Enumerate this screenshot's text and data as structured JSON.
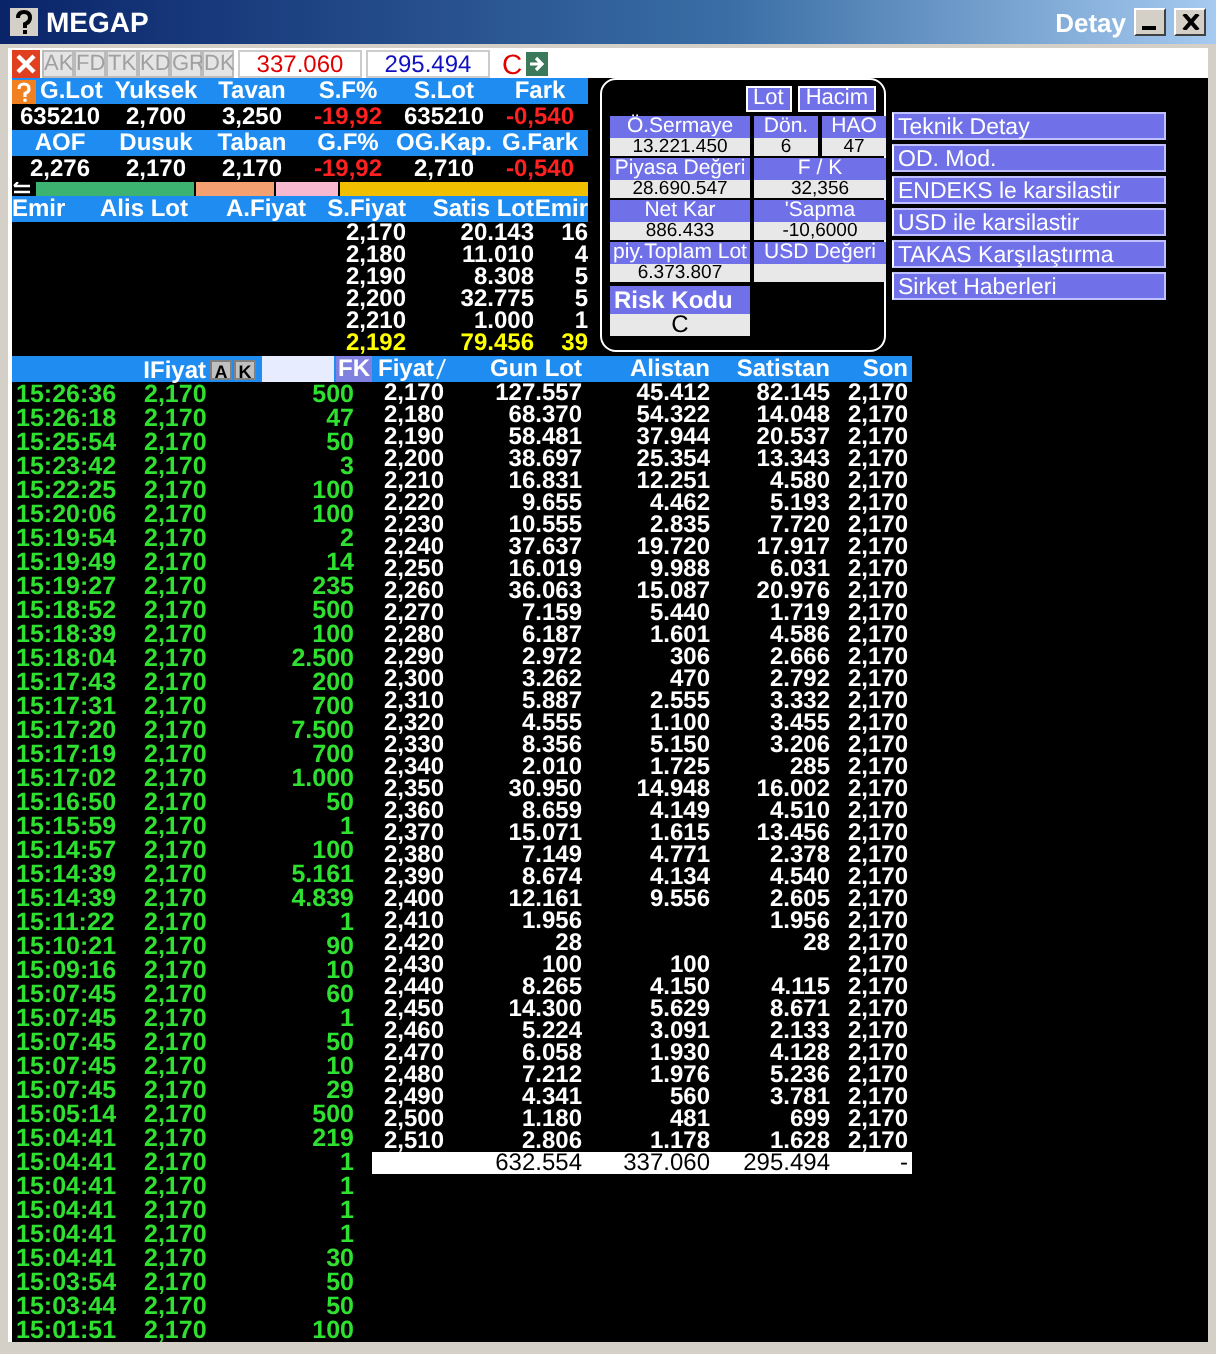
{
  "window": {
    "title": "MEGAP",
    "subtitle": "Detay"
  },
  "toolbar": {
    "tabs": [
      {
        "label": "AK",
        "disabled": true
      },
      {
        "label": "FD",
        "disabled": true
      },
      {
        "label": "TK",
        "disabled": true
      },
      {
        "label": "KD",
        "disabled": true
      },
      {
        "label": "GR",
        "disabled": true
      },
      {
        "label": "DK",
        "disabled": true
      }
    ],
    "buy_total": "337.060",
    "sell_total": "295.494",
    "code": "C"
  },
  "stats": [
    {
      "headers": [
        "G.Lot",
        "Yuksek",
        "Tavan",
        "S.F%",
        "S.Lot",
        "Fark"
      ],
      "values": [
        {
          "text": "635210",
          "negative": false
        },
        {
          "text": "2,700",
          "negative": false
        },
        {
          "text": "3,250",
          "negative": false
        },
        {
          "text": "-19,92",
          "negative": true
        },
        {
          "text": "635210",
          "negative": false
        },
        {
          "text": "-0,540",
          "negative": true
        }
      ]
    },
    {
      "headers": [
        "AOF",
        "Dusuk",
        "Taban",
        "G.F%",
        "OG.Kap.",
        "G.Fark"
      ],
      "values": [
        {
          "text": "2,276",
          "negative": false
        },
        {
          "text": "2,170",
          "negative": false
        },
        {
          "text": "2,170",
          "negative": false
        },
        {
          "text": "-19,92",
          "negative": true
        },
        {
          "text": "2,710",
          "negative": false
        },
        {
          "text": "-0,540",
          "negative": true
        }
      ]
    }
  ],
  "order_book": {
    "columns": [
      "Emir",
      "Alis Lot",
      "A.Fiyat",
      "S.Fiyat",
      "Satis Lot",
      "Emir"
    ],
    "rows": [
      {
        "s_fiyat": "2,170",
        "satis_lot": "20.143",
        "emir": "16"
      },
      {
        "s_fiyat": "2,180",
        "satis_lot": "11.010",
        "emir": "4"
      },
      {
        "s_fiyat": "2,190",
        "satis_lot": "8.308",
        "emir": "5"
      },
      {
        "s_fiyat": "2,200",
        "satis_lot": "32.775",
        "emir": "5"
      },
      {
        "s_fiyat": "2,210",
        "satis_lot": "1.000",
        "emir": "1"
      }
    ],
    "total": {
      "s_fiyat": "2,192",
      "satis_lot": "79.456",
      "emir": "39"
    }
  },
  "detail": {
    "modes": [
      {
        "label": "Lot",
        "selected": false
      },
      {
        "label": "Hacim",
        "selected": false
      }
    ],
    "fields": [
      {
        "kind": "left",
        "label": "Ö.Sermaye",
        "value": "13.221.450"
      },
      {
        "kind": "half",
        "label": "Dön.",
        "value": "6"
      },
      {
        "kind": "half",
        "label": "HAO",
        "value": "47"
      },
      {
        "kind": "left",
        "label": "Piyasa Değeri",
        "value": "28.690.547"
      },
      {
        "kind": "right",
        "label": "F / K",
        "value": "32,356"
      },
      {
        "kind": "left",
        "label": "Net Kar",
        "value": "886.433"
      },
      {
        "kind": "right",
        "label": "'Sapma",
        "value": "-10,6000"
      },
      {
        "kind": "left",
        "label": "piy.Toplam Lot",
        "value": "6.373.807"
      },
      {
        "kind": "right",
        "label": "USD Değeri"
      }
    ],
    "risk": {
      "label": "Risk Kodu",
      "value": "C"
    }
  },
  "links": [
    "Teknik Detay",
    "OD. Mod.",
    "ENDEKS le karsilastir",
    "USD ile karsilastir",
    "TAKAS Karşılaştırma",
    "Sirket Haberleri"
  ],
  "trades": {
    "header": "IFiyat",
    "buttons": [
      "A",
      "K"
    ],
    "filter_button": "FK",
    "rows": [
      [
        "15:26:36",
        "2,170",
        "500"
      ],
      [
        "15:26:18",
        "2,170",
        "47"
      ],
      [
        "15:25:54",
        "2,170",
        "50"
      ],
      [
        "15:23:42",
        "2,170",
        "3"
      ],
      [
        "15:22:25",
        "2,170",
        "100"
      ],
      [
        "15:20:06",
        "2,170",
        "100"
      ],
      [
        "15:19:54",
        "2,170",
        "2"
      ],
      [
        "15:19:49",
        "2,170",
        "14"
      ],
      [
        "15:19:27",
        "2,170",
        "235"
      ],
      [
        "15:18:52",
        "2,170",
        "500"
      ],
      [
        "15:18:39",
        "2,170",
        "100"
      ],
      [
        "15:18:04",
        "2,170",
        "2.500"
      ],
      [
        "15:17:43",
        "2,170",
        "200"
      ],
      [
        "15:17:31",
        "2,170",
        "700"
      ],
      [
        "15:17:20",
        "2,170",
        "7.500"
      ],
      [
        "15:17:19",
        "2,170",
        "700"
      ],
      [
        "15:17:02",
        "2,170",
        "1.000"
      ],
      [
        "15:16:50",
        "2,170",
        "50"
      ],
      [
        "15:15:59",
        "2,170",
        "1"
      ],
      [
        "15:14:57",
        "2,170",
        "100"
      ],
      [
        "15:14:39",
        "2,170",
        "5.161"
      ],
      [
        "15:14:39",
        "2,170",
        "4.839"
      ],
      [
        "15:11:22",
        "2,170",
        "1"
      ],
      [
        "15:10:21",
        "2,170",
        "90"
      ],
      [
        "15:09:16",
        "2,170",
        "10"
      ],
      [
        "15:07:45",
        "2,170",
        "60"
      ],
      [
        "15:07:45",
        "2,170",
        "1"
      ],
      [
        "15:07:45",
        "2,170",
        "50"
      ],
      [
        "15:07:45",
        "2,170",
        "10"
      ],
      [
        "15:07:45",
        "2,170",
        "29"
      ],
      [
        "15:05:14",
        "2,170",
        "500"
      ],
      [
        "15:04:41",
        "2,170",
        "219"
      ],
      [
        "15:04:41",
        "2,170",
        "1"
      ],
      [
        "15:04:41",
        "2,170",
        "1"
      ],
      [
        "15:04:41",
        "2,170",
        "1"
      ],
      [
        "15:04:41",
        "2,170",
        "1"
      ],
      [
        "15:04:41",
        "2,170",
        "30"
      ],
      [
        "15:03:54",
        "2,170",
        "50"
      ],
      [
        "15:03:44",
        "2,170",
        "50"
      ],
      [
        "15:01:51",
        "2,170",
        "100"
      ]
    ]
  },
  "price_table": {
    "columns": [
      "Fiyat",
      "Gun Lot",
      "Alistan",
      "Satistan",
      "Son"
    ],
    "rows": [
      [
        "2,170",
        "127.557",
        "45.412",
        "82.145",
        "2,170"
      ],
      [
        "2,180",
        "68.370",
        "54.322",
        "14.048",
        "2,170"
      ],
      [
        "2,190",
        "58.481",
        "37.944",
        "20.537",
        "2,170"
      ],
      [
        "2,200",
        "38.697",
        "25.354",
        "13.343",
        "2,170"
      ],
      [
        "2,210",
        "16.831",
        "12.251",
        "4.580",
        "2,170"
      ],
      [
        "2,220",
        "9.655",
        "4.462",
        "5.193",
        "2,170"
      ],
      [
        "2,230",
        "10.555",
        "2.835",
        "7.720",
        "2,170"
      ],
      [
        "2,240",
        "37.637",
        "19.720",
        "17.917",
        "2,170"
      ],
      [
        "2,250",
        "16.019",
        "9.988",
        "6.031",
        "2,170"
      ],
      [
        "2,260",
        "36.063",
        "15.087",
        "20.976",
        "2,170"
      ],
      [
        "2,270",
        "7.159",
        "5.440",
        "1.719",
        "2,170"
      ],
      [
        "2,280",
        "6.187",
        "1.601",
        "4.586",
        "2,170"
      ],
      [
        "2,290",
        "2.972",
        "306",
        "2.666",
        "2,170"
      ],
      [
        "2,300",
        "3.262",
        "470",
        "2.792",
        "2,170"
      ],
      [
        "2,310",
        "5.887",
        "2.555",
        "3.332",
        "2,170"
      ],
      [
        "2,320",
        "4.555",
        "1.100",
        "3.455",
        "2,170"
      ],
      [
        "2,330",
        "8.356",
        "5.150",
        "3.206",
        "2,170"
      ],
      [
        "2,340",
        "2.010",
        "1.725",
        "285",
        "2,170"
      ],
      [
        "2,350",
        "30.950",
        "14.948",
        "16.002",
        "2,170"
      ],
      [
        "2,360",
        "8.659",
        "4.149",
        "4.510",
        "2,170"
      ],
      [
        "2,370",
        "15.071",
        "1.615",
        "13.456",
        "2,170"
      ],
      [
        "2,380",
        "7.149",
        "4.771",
        "2.378",
        "2,170"
      ],
      [
        "2,390",
        "8.674",
        "4.134",
        "4.540",
        "2,170"
      ],
      [
        "2,400",
        "12.161",
        "9.556",
        "2.605",
        "2,170"
      ],
      [
        "2,410",
        "1.956",
        null,
        "1.956",
        "2,170"
      ],
      [
        "2,420",
        "28",
        null,
        "28",
        "2,170"
      ],
      [
        "2,430",
        "100",
        "100",
        null,
        "2,170"
      ],
      [
        "2,440",
        "8.265",
        "4.150",
        "4.115",
        "2,170"
      ],
      [
        "2,450",
        "14.300",
        "5.629",
        "8.671",
        "2,170"
      ],
      [
        "2,460",
        "5.224",
        "3.091",
        "2.133",
        "2,170"
      ],
      [
        "2,470",
        "6.058",
        "1.930",
        "4.128",
        "2,170"
      ],
      [
        "2,480",
        "7.212",
        "1.976",
        "5.236",
        "2,170"
      ],
      [
        "2,490",
        "4.341",
        "560",
        "3.781",
        "2,170"
      ],
      [
        "2,500",
        "1.180",
        "481",
        "699",
        "2,170"
      ],
      [
        "2,510",
        "2.806",
        "1.178",
        "1.628",
        "2,170"
      ]
    ],
    "total": {
      "gun_lot": "632.554",
      "alistan": "337.060",
      "satistan": "295.494",
      "son": "-"
    }
  }
}
